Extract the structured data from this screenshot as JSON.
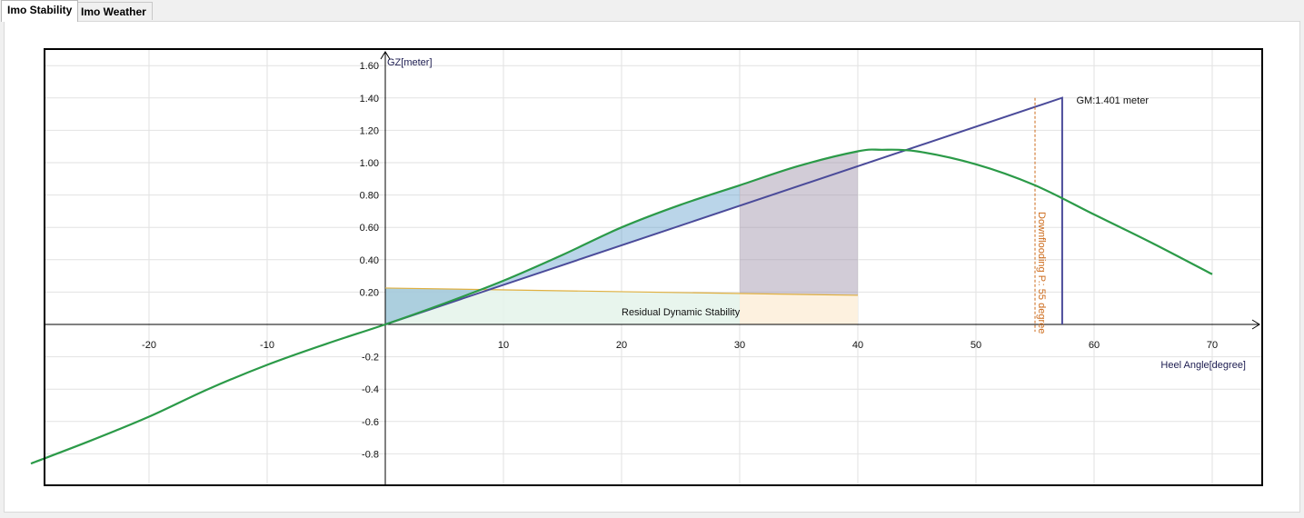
{
  "tabs": [
    {
      "label": "Imo Stability",
      "active": true
    },
    {
      "label": "Imo Weather",
      "active": false
    }
  ],
  "chart_data": {
    "type": "line",
    "xlabel": "Heel Angle[degree]",
    "ylabel": "GZ[meter]",
    "xlim": [
      -30,
      73
    ],
    "ylim": [
      -0.98,
      1.68
    ],
    "x_ticks": [
      -20,
      -10,
      10,
      20,
      30,
      40,
      50,
      60,
      70
    ],
    "y_ticks": [
      {
        "v": 1.6,
        "label": "1.60"
      },
      {
        "v": 1.4,
        "label": "1.40"
      },
      {
        "v": 1.2,
        "label": "1.20"
      },
      {
        "v": 1.0,
        "label": "1.00"
      },
      {
        "v": 0.8,
        "label": "0.80"
      },
      {
        "v": 0.6,
        "label": "0.60"
      },
      {
        "v": 0.4,
        "label": "0.40"
      },
      {
        "v": 0.2,
        "label": "0.20"
      },
      {
        "v": -0.2,
        "label": "-0.2"
      },
      {
        "v": -0.4,
        "label": "-0.4"
      },
      {
        "v": -0.6,
        "label": "-0.6"
      },
      {
        "v": -0.8,
        "label": "-0.8"
      }
    ],
    "grid": true,
    "series": [
      {
        "type": "curve",
        "color": "#2b9a48",
        "x": [
          -30,
          -25,
          -20,
          -15,
          -10,
          -5,
          0,
          5,
          10,
          15,
          20,
          25,
          30,
          35,
          40,
          42,
          45,
          50,
          55,
          60,
          65,
          70
        ],
        "y": [
          -0.86,
          -0.72,
          -0.57,
          -0.4,
          -0.25,
          -0.12,
          0.0,
          0.13,
          0.27,
          0.43,
          0.6,
          0.74,
          0.86,
          0.98,
          1.07,
          1.08,
          1.07,
          0.99,
          0.86,
          0.68,
          0.5,
          0.31
        ]
      },
      {
        "type": "gm-line",
        "color": "#4b4b9a",
        "x": [
          0,
          57.3,
          57.3
        ],
        "y": [
          0,
          1.401,
          0
        ]
      },
      {
        "type": "heeling-arm",
        "color": "#e0b040",
        "x": [
          0,
          40
        ],
        "y": [
          0.225,
          0.18
        ]
      }
    ],
    "areas": [
      {
        "from": 0,
        "to": 30,
        "color": "#4a90c4"
      },
      {
        "from": 30,
        "to": 40,
        "color": "#9c8fa6"
      }
    ],
    "downflooding": {
      "x": 55,
      "label": "Downflooding P.: 55 degree",
      "color": "#cc6a1a"
    },
    "annotations": [
      {
        "text": "GM:1.401 meter",
        "x": 58.5,
        "y": 1.365
      },
      {
        "text": "Residual Dynamic Stability",
        "x": 20,
        "y": 0.055
      }
    ]
  }
}
